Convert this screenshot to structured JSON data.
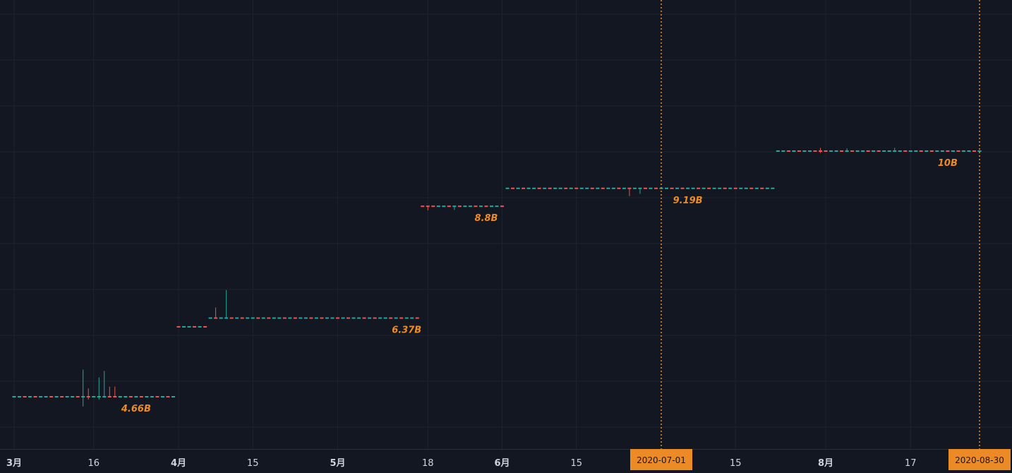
{
  "chart_data": {
    "type": "candlestick",
    "colors": {
      "background": "#131722",
      "grid": "#1e2330",
      "up": "#26a69a",
      "down": "#ef5350",
      "annotation": "#ec8b25",
      "axis_text": "#d1d4dc"
    },
    "x_range": [
      "2020-03-01",
      "2020-08-31"
    ],
    "y_range": [
      3.0,
      12.0
    ],
    "grid": true,
    "x_ticks": [
      {
        "date": "2020-03-01",
        "label": "3月",
        "bold": true
      },
      {
        "date": "2020-03-16",
        "label": "16",
        "bold": false
      },
      {
        "date": "2020-04-01",
        "label": "4月",
        "bold": true
      },
      {
        "date": "2020-04-15",
        "label": "15",
        "bold": false
      },
      {
        "date": "2020-05-01",
        "label": "5月",
        "bold": true
      },
      {
        "date": "2020-05-18",
        "label": "18",
        "bold": false
      },
      {
        "date": "2020-06-01",
        "label": "6月",
        "bold": true
      },
      {
        "date": "2020-06-15",
        "label": "15",
        "bold": false
      },
      {
        "date": "2020-07-15",
        "label": "15",
        "bold": false
      },
      {
        "date": "2020-08-01",
        "label": "8月",
        "bold": true
      },
      {
        "date": "2020-08-17",
        "label": "17",
        "bold": false
      }
    ],
    "crosshair_markers": [
      {
        "date": "2020-07-01",
        "label": "2020-07-01"
      },
      {
        "date": "2020-08-30",
        "label": "2020-08-30"
      }
    ],
    "segments": [
      {
        "start": "2020-03-01",
        "end": "2020-03-31",
        "level": 4.66,
        "label": "4.66B",
        "label_date": "2020-03-24",
        "spikes": [
          {
            "date": "2020-03-14",
            "high": 5.25,
            "low": 4.45,
            "dir": "up"
          },
          {
            "date": "2020-03-15",
            "high": 4.84,
            "low": 4.6,
            "dir": "down"
          },
          {
            "date": "2020-03-17",
            "high": 5.08,
            "low": 4.6,
            "dir": "up"
          },
          {
            "date": "2020-03-18",
            "high": 5.22,
            "low": 4.66,
            "dir": "up"
          },
          {
            "date": "2020-03-19",
            "high": 4.88,
            "low": 4.66,
            "dir": "down"
          },
          {
            "date": "2020-03-20",
            "high": 4.88,
            "low": 4.66,
            "dir": "down"
          }
        ]
      },
      {
        "start": "2020-04-01",
        "end": "2020-04-06",
        "level": 6.18,
        "label": "",
        "label_date": "",
        "spikes": []
      },
      {
        "start": "2020-04-07",
        "end": "2020-05-16",
        "level": 6.37,
        "label": "6.37B",
        "label_date": "2020-05-14",
        "spikes": [
          {
            "date": "2020-04-08",
            "high": 6.6,
            "low": 6.37,
            "dir": "down"
          },
          {
            "date": "2020-04-10",
            "high": 6.98,
            "low": 6.37,
            "dir": "up"
          }
        ]
      },
      {
        "start": "2020-05-17",
        "end": "2020-06-01",
        "level": 8.8,
        "label": "8.8B",
        "label_date": "2020-05-29",
        "spikes": [
          {
            "date": "2020-05-18",
            "high": 8.8,
            "low": 8.71,
            "dir": "down"
          },
          {
            "date": "2020-05-23",
            "high": 8.8,
            "low": 8.72,
            "dir": "up"
          }
        ]
      },
      {
        "start": "2020-06-02",
        "end": "2020-07-22",
        "level": 9.19,
        "label": "9.19B",
        "label_date": "2020-07-06",
        "spikes": [
          {
            "date": "2020-06-25",
            "high": 9.19,
            "low": 9.02,
            "dir": "down"
          },
          {
            "date": "2020-06-27",
            "high": 9.19,
            "low": 9.07,
            "dir": "up"
          }
        ]
      },
      {
        "start": "2020-07-23",
        "end": "2020-08-30",
        "level": 10.0,
        "label": "10B",
        "label_date": "2020-08-24",
        "spikes": [
          {
            "date": "2020-07-31",
            "high": 10.07,
            "low": 9.96,
            "dir": "down"
          },
          {
            "date": "2020-08-05",
            "high": 10.06,
            "low": 9.98,
            "dir": "up"
          },
          {
            "date": "2020-08-14",
            "high": 10.07,
            "low": 9.98,
            "dir": "up"
          }
        ]
      }
    ]
  }
}
